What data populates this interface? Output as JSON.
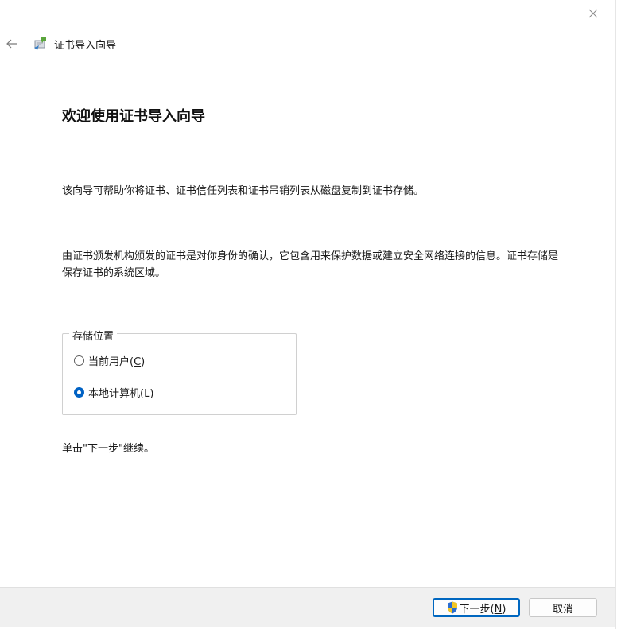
{
  "window": {
    "title": "证书导入向导"
  },
  "icons": {
    "close": "close-icon",
    "back": "arrow-left-icon",
    "wizard": "certificate-wizard-icon",
    "shield": "uac-shield-icon"
  },
  "content": {
    "heading": "欢迎使用证书导入向导",
    "paragraph1": "该向导可帮助你将证书、证书信任列表和证书吊销列表从磁盘复制到证书存储。",
    "paragraph2": "由证书颁发机构颁发的证书是对你身份的确认，它包含用来保护数据或建立安全网络连接的信息。证书存储是保存证书的系统区域。",
    "continue_hint": "单击\"下一步\"继续。"
  },
  "store_location": {
    "legend": "存储位置",
    "options": [
      {
        "label": "当前用户(",
        "mnemonic": "C",
        "suffix": ")",
        "checked": false
      },
      {
        "label": "本地计算机(",
        "mnemonic": "L",
        "suffix": ")",
        "checked": true
      }
    ]
  },
  "buttons": {
    "next_label": "下一步(",
    "next_mnemonic": "N",
    "next_suffix": ")",
    "cancel_label": "取消"
  },
  "colors": {
    "accent": "#0067c0",
    "footer_bg": "#f0f0f0"
  }
}
